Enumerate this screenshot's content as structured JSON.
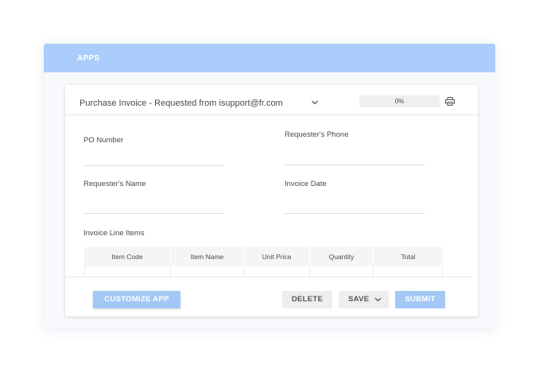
{
  "window": {
    "title": "APPS"
  },
  "form": {
    "title": "Purchase Invoice - Requested from isupport@fr.com",
    "progress_label": "0%",
    "progress_value": 0
  },
  "fields": {
    "po_number": {
      "label": "PO Number",
      "value": ""
    },
    "requester_phone": {
      "label": "Requester's Phone",
      "value": ""
    },
    "requester_name": {
      "label": "Requester's Name",
      "value": ""
    },
    "invoice_date": {
      "label": "Invoice Date",
      "value": ""
    }
  },
  "line_items": {
    "label": "Invoice Line Items",
    "columns": [
      "Item Code",
      "Item Name",
      "Unit Price",
      "Quantity",
      "Total"
    ]
  },
  "actions": {
    "customize_label": "CUSTOMIZE APP",
    "delete_label": "DELETE",
    "save_label": "SAVE",
    "submit_label": "SUBMIT"
  },
  "colors": {
    "accent": "#abcdfb",
    "button_primary": "#a3c8f6",
    "button_secondary": "#eeeeee"
  },
  "icons": {
    "form_selector": "chevron-down-icon",
    "print": "printer-icon",
    "save_menu": "chevron-down-icon"
  }
}
